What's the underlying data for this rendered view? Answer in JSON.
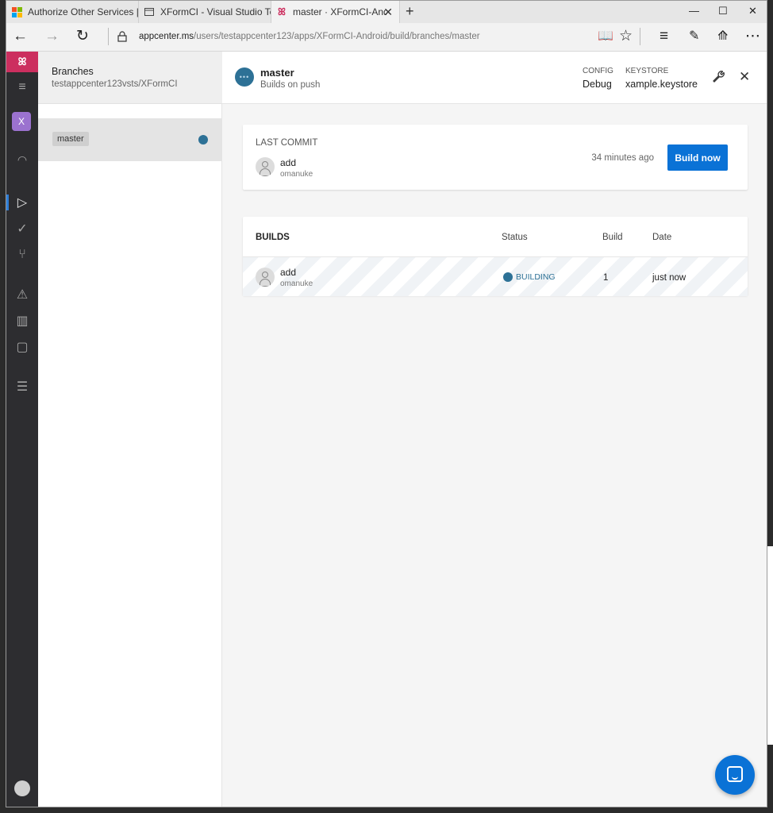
{
  "browser": {
    "tabs": [
      {
        "title": "Authorize Other Services | M"
      },
      {
        "title": "XFormCI - Visual Studio Tean"
      },
      {
        "title": "master · XFormCI-Andro"
      }
    ],
    "url_host": "appcenter.ms",
    "url_path": "/users/testappcenter123/apps/XFormCI-Android/build/branches/master"
  },
  "rail": {
    "logo": "ꕤ",
    "app_initial": "X"
  },
  "branches_panel": {
    "title": "Branches",
    "subtitle": "testappcenter123vsts/XFormCI",
    "items": [
      {
        "name": "master"
      }
    ]
  },
  "header": {
    "badge": "•••",
    "branch": "master",
    "subtitle": "Builds on push",
    "config_label": "CONFIG",
    "config_value": "Debug",
    "keystore_label": "KEYSTORE",
    "keystore_value": "xample.keystore"
  },
  "last_commit": {
    "label": "LAST COMMIT",
    "message": "add",
    "author": "omanuke",
    "time": "34 minutes ago",
    "button": "Build now"
  },
  "builds": {
    "title": "BUILDS",
    "columns": [
      "Status",
      "Build",
      "Date"
    ],
    "rows": [
      {
        "message": "add",
        "author": "omanuke",
        "status": "BUILDING",
        "build": "1",
        "date": "just now"
      }
    ]
  },
  "colors": {
    "accent": "#0a72d6",
    "brand": "#cc2f5f",
    "status_building": "#2d7196",
    "app_avatar": "#9b72cf"
  }
}
